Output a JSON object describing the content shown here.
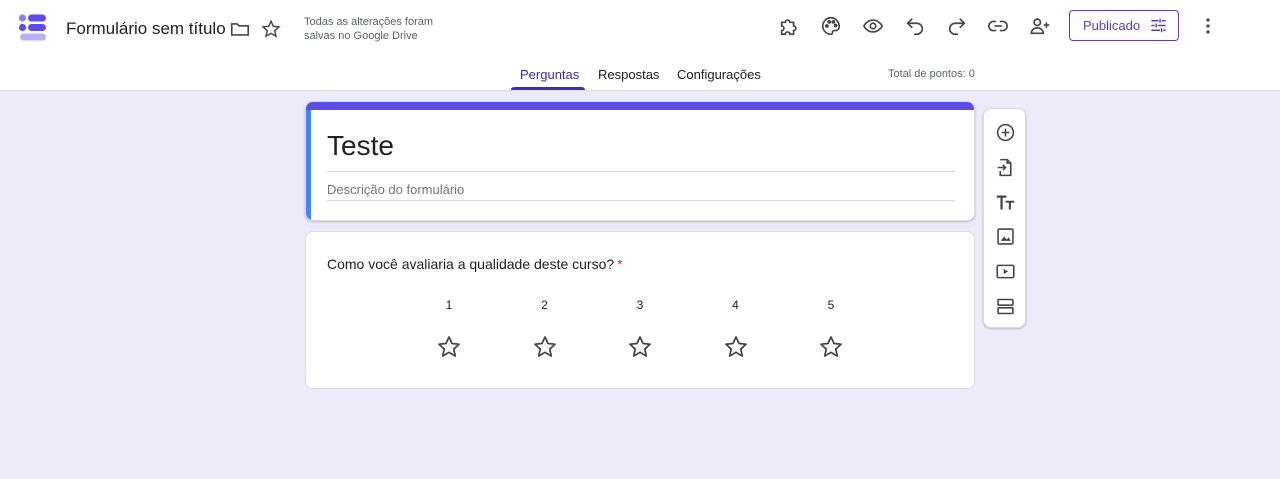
{
  "header": {
    "title": "Formulário sem título",
    "save_status": "Todas as alterações foram salvas no Google Drive",
    "publish_label": "Publicado",
    "icons": [
      "folder-icon",
      "star-icon",
      "addons-icon",
      "palette-icon",
      "preview-icon",
      "undo-icon",
      "redo-icon",
      "link-icon",
      "add-collaborator-icon",
      "more-icon"
    ]
  },
  "tabs": [
    {
      "label": "Perguntas",
      "active": true
    },
    {
      "label": "Respostas",
      "active": false
    },
    {
      "label": "Configurações",
      "active": false
    }
  ],
  "points": "Total de pontos: 0",
  "form": {
    "title": "Teste",
    "description_placeholder": "Descrição do formulário"
  },
  "question": {
    "text": "Como você avaliaria a qualidade deste curso?",
    "required_mark": "*",
    "rating_levels": [
      "1",
      "2",
      "3",
      "4",
      "5"
    ]
  },
  "toolbar": {
    "icons": [
      "add-question-icon",
      "import-questions-icon",
      "add-title-icon",
      "add-image-icon",
      "add-video-icon",
      "add-section-icon"
    ]
  },
  "colors": {
    "accent": "#673ab7",
    "tab_active": "#3b2ea8",
    "form_top_bar": "#5c4ee5",
    "form_left_bar": "#4285f4",
    "background": "#edeaf9",
    "required": "#d93025"
  }
}
